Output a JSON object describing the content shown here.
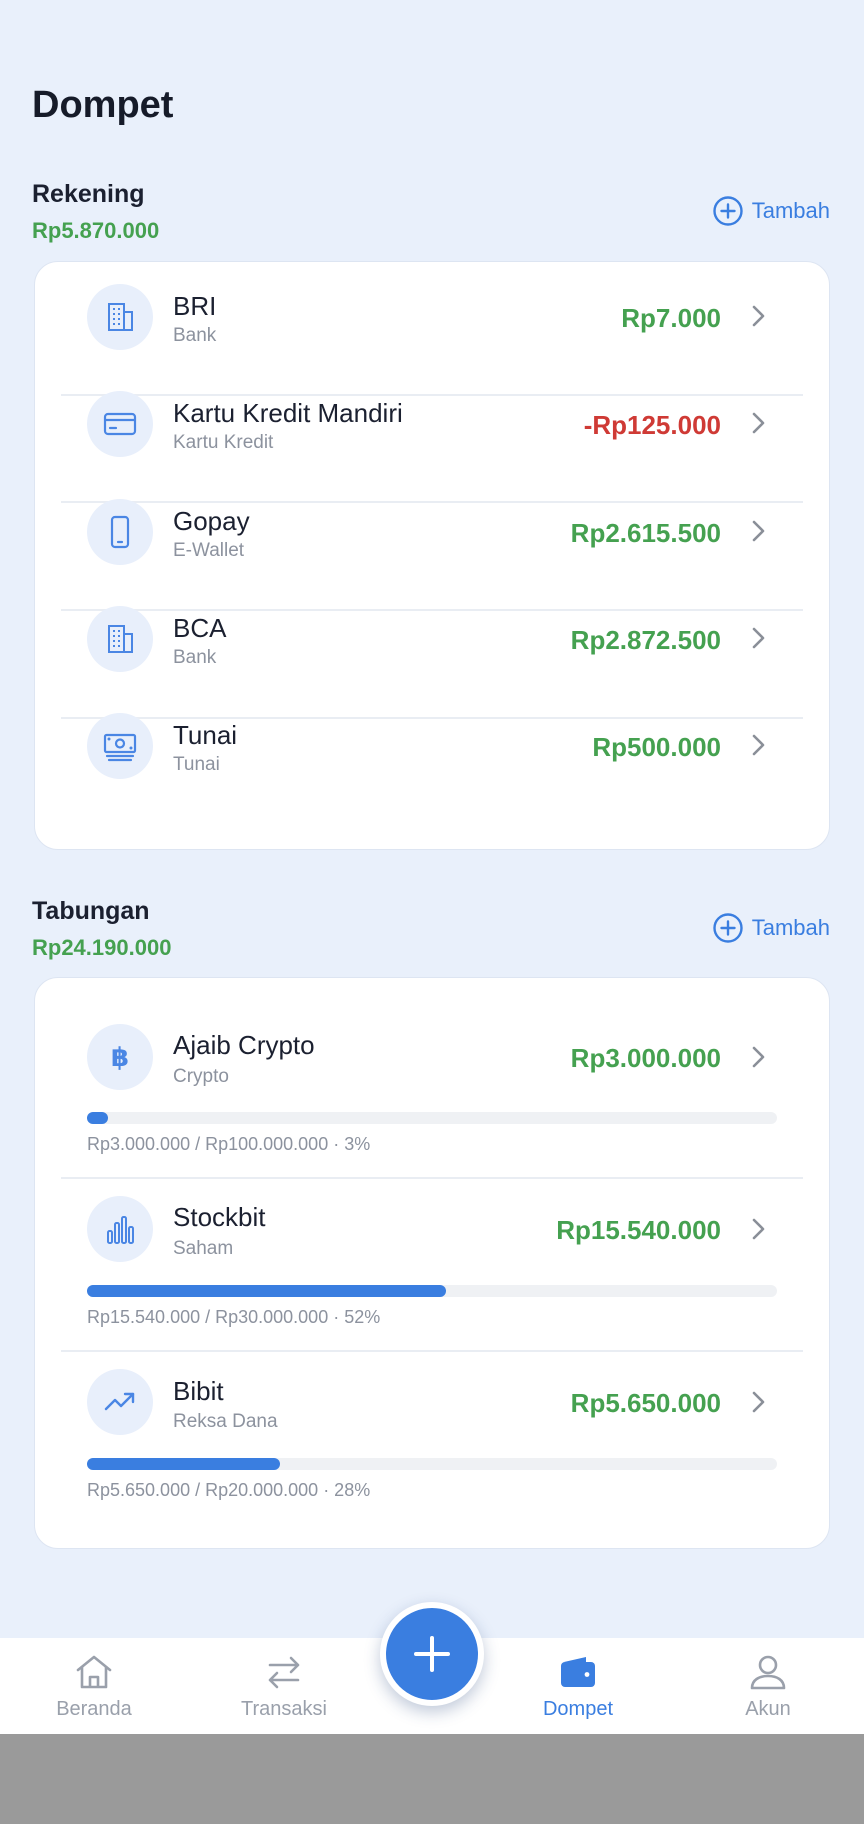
{
  "page": {
    "title": "Dompet"
  },
  "rekening": {
    "title": "Rekening",
    "total": "Rp5.870.000",
    "add_label": "Tambah",
    "accounts": [
      {
        "name": "BRI",
        "type": "Bank",
        "amount": "Rp7.000",
        "icon": "building-icon"
      },
      {
        "name": "Kartu Kredit Mandiri",
        "type": "Kartu Kredit",
        "amount": "-Rp125.000",
        "icon": "credit-card-icon"
      },
      {
        "name": "Gopay",
        "type": "E-Wallet",
        "amount": "Rp2.615.500",
        "icon": "smartphone-icon"
      },
      {
        "name": "BCA",
        "type": "Bank",
        "amount": "Rp2.872.500",
        "icon": "building-icon"
      },
      {
        "name": "Tunai",
        "type": "Tunai",
        "amount": "Rp500.000",
        "icon": "cash-icon"
      }
    ]
  },
  "tabungan": {
    "title": "Tabungan",
    "total": "Rp24.190.000",
    "add_label": "Tambah",
    "goals": [
      {
        "name": "Ajaib Crypto",
        "type": "Crypto",
        "amount": "Rp3.000.000",
        "progress_text": "Rp3.000.000 / Rp100.000.000 · 3%",
        "progress": 0.03,
        "icon": "bitcoin-icon"
      },
      {
        "name": "Stockbit",
        "type": "Saham",
        "amount": "Rp15.540.000",
        "progress_text": "Rp15.540.000 / Rp30.000.000 · 52%",
        "progress": 0.52,
        "icon": "bar-chart-icon"
      },
      {
        "name": "Bibit",
        "type": "Reksa Dana",
        "amount": "Rp5.650.000",
        "progress_text": "Rp5.650.000 / Rp20.000.000 · 28%",
        "progress": 0.28,
        "icon": "trending-up-icon"
      }
    ]
  },
  "nav": {
    "items": [
      {
        "label": "Beranda",
        "icon": "home-icon",
        "active": false
      },
      {
        "label": "Transaksi",
        "icon": "transfer-arrows-icon",
        "active": false
      },
      {
        "label": "Dompet",
        "icon": "wallet-icon",
        "active": true
      },
      {
        "label": "Akun",
        "icon": "user-icon",
        "active": false
      }
    ],
    "fab_icon": "plus-icon"
  },
  "colors": {
    "background": "#e9f0fb",
    "accent": "#3a7ee0",
    "positive": "#45a150",
    "negative": "#cf3a35"
  }
}
